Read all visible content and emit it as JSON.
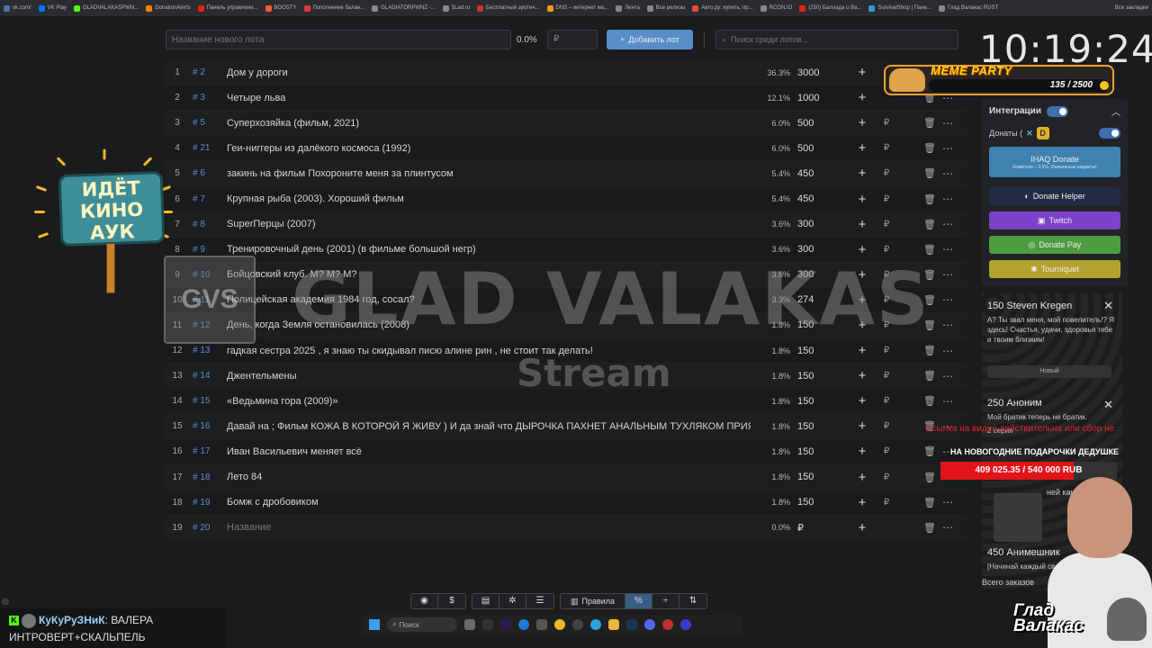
{
  "bookmarks": [
    {
      "label": "vk.com/",
      "color": "#4a76a8"
    },
    {
      "label": "VK Play",
      "color": "#0077ff"
    },
    {
      "label": "GLADVALAKASPWN...",
      "color": "#53fc18"
    },
    {
      "label": "DonationAlerts",
      "color": "#f57d07"
    },
    {
      "label": "Панель управлени...",
      "color": "#e62117"
    },
    {
      "label": "BOOSTY",
      "color": "#f15f2c"
    },
    {
      "label": "Пополнение балан...",
      "color": "#e03b3b"
    },
    {
      "label": "GLADIATORPWNZ -...",
      "color": "#888888"
    },
    {
      "label": "5Lad.ru",
      "color": "#888888"
    },
    {
      "label": "Бесплатный эротич...",
      "color": "#c0392b"
    },
    {
      "label": "DNS – интернет ма...",
      "color": "#f39c12"
    },
    {
      "label": "Лента",
      "color": "#888888"
    },
    {
      "label": "Все релизы",
      "color": "#888888"
    },
    {
      "label": "Авто.ру: купить, пр...",
      "color": "#e74c3c"
    },
    {
      "label": "RCON.IO",
      "color": "#888888"
    },
    {
      "label": "(250) Баллада о Ва...",
      "color": "#e62117"
    },
    {
      "label": "SurvivalShop | Пане...",
      "color": "#3498db"
    },
    {
      "label": "Глад Валакас RUST",
      "color": "#888888"
    }
  ],
  "bookmarks_all": "Все закладки",
  "top": {
    "lot_placeholder": "Название нового лота",
    "percent": "0.0%",
    "currency": "₽",
    "add_label": "Добавить лот",
    "search_placeholder": "Поиск среди лотов..."
  },
  "lots": [
    {
      "n": "1",
      "id": "# 2",
      "name": "Дом у дороги",
      "pct": "36.3%",
      "amount": "3000",
      "rub": ""
    },
    {
      "n": "2",
      "id": "# 3",
      "name": "Четыре льва",
      "pct": "12.1%",
      "amount": "1000",
      "rub": ""
    },
    {
      "n": "3",
      "id": "# 5",
      "name": "Суперхозяйка (фильм, 2021)",
      "pct": "6.0%",
      "amount": "500",
      "rub": "₽"
    },
    {
      "n": "4",
      "id": "# 21",
      "name": "Геи-ниггеры из далёкого космоса (1992)",
      "pct": "6.0%",
      "amount": "500",
      "rub": "₽"
    },
    {
      "n": "5",
      "id": "# 6",
      "name": "закинь на фильм Похороните меня за плинтусом",
      "pct": "5.4%",
      "amount": "450",
      "rub": "₽"
    },
    {
      "n": "6",
      "id": "# 7",
      "name": "Крупная рыба (2003). Хороший фильм",
      "pct": "5.4%",
      "amount": "450",
      "rub": "₽"
    },
    {
      "n": "7",
      "id": "# 8",
      "name": "SuperПерцы (2007)",
      "pct": "3.6%",
      "amount": "300",
      "rub": "₽"
    },
    {
      "n": "8",
      "id": "# 9",
      "name": "Тренировочный день (2001) (в фильме большой негр)",
      "pct": "3.6%",
      "amount": "300",
      "rub": "₽"
    },
    {
      "n": "9",
      "id": "# 10",
      "name": "Бойцовский клуб. М? М? М?",
      "pct": "3.6%",
      "amount": "300",
      "rub": "₽"
    },
    {
      "n": "10",
      "id": "# 11",
      "name": "Полицейская академия 1984 год, сосал?",
      "pct": "3.3%",
      "amount": "274",
      "rub": "₽"
    },
    {
      "n": "11",
      "id": "# 12",
      "name": "День, когда Земля остановилась (2008)",
      "pct": "1.8%",
      "amount": "150",
      "rub": "₽"
    },
    {
      "n": "12",
      "id": "# 13",
      "name": "гадкая сестра 2025 , я знаю ты скидывал писю алине рин , не стоит так делать!",
      "pct": "1.8%",
      "amount": "150",
      "rub": "₽"
    },
    {
      "n": "13",
      "id": "# 14",
      "name": "Джентельмены",
      "pct": "1.8%",
      "amount": "150",
      "rub": "₽"
    },
    {
      "n": "14",
      "id": "# 15",
      "name": "«Ведьмина гора (2009)»",
      "pct": "1.8%",
      "amount": "150",
      "rub": "₽"
    },
    {
      "n": "15",
      "id": "# 16",
      "name": "Давай на ; Фильм КОЖА В КОТОРОЙ Я ЖИВУ ) И да знай что ДЫРОЧКА ПАХНЕТ АНАЛЬНЫМ ТУХЛЯКОМ ПРИЯТН",
      "pct": "1.8%",
      "amount": "150",
      "rub": "₽"
    },
    {
      "n": "16",
      "id": "# 17",
      "name": "Иван Васильевич меняет всё",
      "pct": "1.8%",
      "amount": "150",
      "rub": "₽"
    },
    {
      "n": "17",
      "id": "# 18",
      "name": "Лето 84",
      "pct": "1.8%",
      "amount": "150",
      "rub": "₽"
    },
    {
      "n": "18",
      "id": "# 19",
      "name": "Бомж с дробовиком",
      "pct": "1.8%",
      "amount": "150",
      "rub": "₽"
    },
    {
      "n": "19",
      "id": "# 20",
      "name": "Название",
      "pct": "0.0%",
      "amount": "₽",
      "rub": "",
      "placeholder": true
    }
  ],
  "watermark": {
    "logo": "GVS",
    "title": "GLAD VALAKAS",
    "sub": "Stream"
  },
  "sign": {
    "line1": "ИДЁТ",
    "line2": "КИНО",
    "line3": "АУК"
  },
  "clock": "10:19:24",
  "meme": {
    "title": "MEME PARTY",
    "progress": "135 / 2500"
  },
  "integrations": {
    "title": "Интеграции",
    "donats_label": "Донаты (",
    "services": [
      {
        "label": "IHAQ Donate",
        "sub": "Комиссия – 3,5%. Уникальные виджеты!"
      },
      {
        "label": "Donate Helper"
      },
      {
        "label": "Twitch"
      },
      {
        "label": "Donate Pay"
      },
      {
        "label": "Tourniquet"
      }
    ]
  },
  "feed": {
    "d1_title": "150 Steven Kregen",
    "d1_text": "А? Ты звал меня, мой повелитель!? Я здесь! Счастья, удачи, здоровья тебе и твоим близким!",
    "select": "Новый",
    "d2_title": "250 Аноним",
    "d2_text": "Мой братик теперь не братик.",
    "partial1": "2 серия",
    "partial2": "ней какое",
    "d3_title": "450 Анимешник",
    "d3_text": "[Начинай каждый свой",
    "footer": "Всего заказов"
  },
  "red_line": "Ссылка на видео действительна или сбор не",
  "goal": {
    "title": "НА НОВОГОДНИЕ ПОДАРОЧКИ ДЕДУШКЕ",
    "text": "409 025.35 / 540 000 RUB",
    "fraction": 0.7575
  },
  "streamer_name": {
    "l1": "Глад",
    "l2": "Валакас"
  },
  "tools": {
    "rules": "Правила",
    "percent": "%"
  },
  "chat": {
    "user": "КуКуРуЗНиК",
    "msg1": ": ВАЛЕРА",
    "msg2": "ИНТРОВЕРТ+СКАЛЬПЕЛЬ"
  },
  "taskbar": {
    "search": "Поиск"
  }
}
